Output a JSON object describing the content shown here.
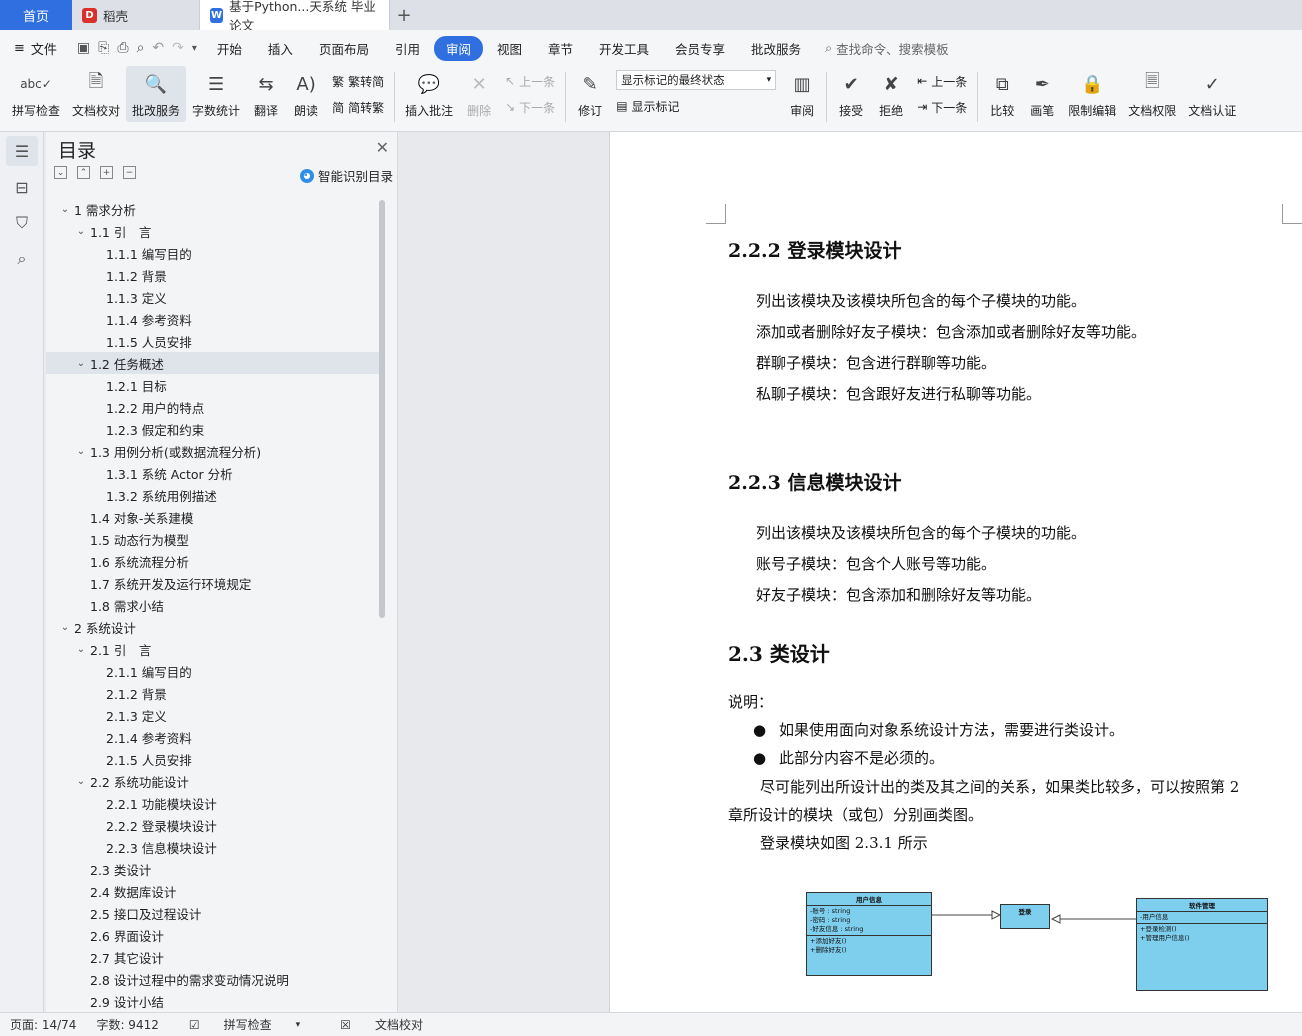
{
  "tabs": {
    "home": "首页",
    "daoke": "稻壳",
    "doc": "基于Python...天系统 毕业论文"
  },
  "menu": {
    "file": "文件",
    "tabs": [
      "开始",
      "插入",
      "页面布局",
      "引用",
      "审阅",
      "视图",
      "章节",
      "开发工具",
      "会员专享",
      "批改服务"
    ],
    "active_tab": "审阅",
    "search": "查找命令、搜索模板"
  },
  "ribbon": {
    "spellcheck": "拼写检查",
    "proofread": "文档校对",
    "correction": "批改服务",
    "wordcount": "字数统计",
    "translate": "翻译",
    "read": "朗读",
    "trad": "繁转简",
    "simp": "简转繁",
    "insert_comment": "插入批注",
    "delete": "删除",
    "prev": "上一条",
    "next": "下一条",
    "revise": "修订",
    "markup_state": "显示标记的最终状态",
    "show_markup": "显示标记",
    "review": "审阅",
    "accept": "接受",
    "reject": "拒绝",
    "prev2": "上一条",
    "next2": "下一条",
    "compare": "比较",
    "pen": "画笔",
    "restrict": "限制编辑",
    "permission": "文档权限",
    "certify": "文档认证"
  },
  "toc": {
    "title": "目录",
    "smart": "智能识别目录",
    "items": [
      {
        "t": "1  需求分析",
        "lvl": 0,
        "chev": "v"
      },
      {
        "t": "1.1  引　言",
        "lvl": 1,
        "chev": "v"
      },
      {
        "t": "1.1.1  编写目的",
        "lvl": 2,
        "chev": ""
      },
      {
        "t": "1.1.2 背景",
        "lvl": 2,
        "chev": ""
      },
      {
        "t": "1.1.3 定义",
        "lvl": 2,
        "chev": ""
      },
      {
        "t": "1.1.4 参考资料",
        "lvl": 2,
        "chev": ""
      },
      {
        "t": "1.1.5  人员安排",
        "lvl": 2,
        "chev": ""
      },
      {
        "t": "1.2  任务概述",
        "lvl": 1,
        "chev": "v",
        "sel": true
      },
      {
        "t": "1.2.1 目标",
        "lvl": 2,
        "chev": ""
      },
      {
        "t": "1.2.2 用户的特点",
        "lvl": 2,
        "chev": ""
      },
      {
        "t": "1.2.3 假定和约束",
        "lvl": 2,
        "chev": ""
      },
      {
        "t": "1.3  用例分析(或数据流程分析)",
        "lvl": 1,
        "chev": "v"
      },
      {
        "t": "1.3.1  系统 Actor 分析",
        "lvl": 2,
        "chev": ""
      },
      {
        "t": "1.3.2  系统用例描述",
        "lvl": 2,
        "chev": ""
      },
      {
        "t": "1.4  对象-关系建模",
        "lvl": 1,
        "chev": ""
      },
      {
        "t": "1.5  动态行为模型",
        "lvl": 1,
        "chev": ""
      },
      {
        "t": "1.6  系统流程分析",
        "lvl": 1,
        "chev": ""
      },
      {
        "t": "1.7  系统开发及运行环境规定",
        "lvl": 1,
        "chev": ""
      },
      {
        "t": "1.8  需求小结",
        "lvl": 1,
        "chev": ""
      },
      {
        "t": "2  系统设计",
        "lvl": 0,
        "chev": "v"
      },
      {
        "t": "2.1  引　言",
        "lvl": 1,
        "chev": "v"
      },
      {
        "t": "2.1.1 编写目的",
        "lvl": 2,
        "chev": ""
      },
      {
        "t": "2.1.2 背景",
        "lvl": 2,
        "chev": ""
      },
      {
        "t": "2.1.3 定义",
        "lvl": 2,
        "chev": ""
      },
      {
        "t": "2.1.4 参考资料",
        "lvl": 2,
        "chev": ""
      },
      {
        "t": "2.1.5 人员安排",
        "lvl": 2,
        "chev": ""
      },
      {
        "t": "2.2  系统功能设计",
        "lvl": 1,
        "chev": "v"
      },
      {
        "t": "2.2.1  功能模块设计",
        "lvl": 2,
        "chev": ""
      },
      {
        "t": "2.2.2  登录模块设计",
        "lvl": 2,
        "chev": ""
      },
      {
        "t": "2.2.3  信息模块设计",
        "lvl": 2,
        "chev": ""
      },
      {
        "t": "2.3  类设计",
        "lvl": 1,
        "chev": ""
      },
      {
        "t": "2.4  数据库设计",
        "lvl": 1,
        "chev": ""
      },
      {
        "t": "2.5  接口及过程设计",
        "lvl": 1,
        "chev": ""
      },
      {
        "t": "2.6  界面设计",
        "lvl": 1,
        "chev": ""
      },
      {
        "t": "2.7  其它设计",
        "lvl": 1,
        "chev": ""
      },
      {
        "t": "2.8  设计过程中的需求变动情况说明",
        "lvl": 1,
        "chev": ""
      },
      {
        "t": "2.9  设计小结",
        "lvl": 1,
        "chev": ""
      }
    ]
  },
  "doc": {
    "h_222": "2.2.2  登录模块设计",
    "p1": "列出该模块及该模块所包含的每个子模块的功能。",
    "p2": "添加或者删除好友子模块：包含添加或者删除好友等功能。",
    "p3": "群聊子模块：包含进行群聊等功能。",
    "p4": "私聊子模块：包含跟好友进行私聊等功能。",
    "h_223": "2.2.3  信息模块设计",
    "p5": "列出该模块及该模块所包含的每个子模块的功能。",
    "p6": "账号子模块：包含个人账号等功能。",
    "p7": "好友子模块：包含添加和删除好友等功能。",
    "h_23": "2.3  类设计",
    "p8": "说明：",
    "b1": "如果使用面向对象系统设计方法，需要进行类设计。",
    "b2": "此部分内容不是必须的。",
    "p9": "尽可能列出所设计出的类及其之间的关系，如果类比较多，可以按照第 2",
    "p10": "章所设计的模块（或包）分别画类图。",
    "p11": "登录模块如图 2.3.1 所示",
    "bullet_glyph": "●"
  },
  "uml": {
    "user_title": "用户信息",
    "user_attrs": [
      "-账号 : string",
      "-密码 : string",
      "-好友信息 : string"
    ],
    "user_ops": [
      "+添加好友()",
      "+删除好友()"
    ],
    "login_title": "登录",
    "soft_title": "软件管理",
    "soft_attrs": [
      "-用户信息"
    ],
    "soft_ops": [
      "+登录检测()",
      "+管理用户信息()"
    ]
  },
  "status": {
    "page": "页面: 14/74",
    "words": "字数: 9412",
    "spell": "拼写检查",
    "proof": "文档校对"
  },
  "colors": {
    "accent": "#2f6fe0",
    "uml_fill": "#7ecfee"
  }
}
